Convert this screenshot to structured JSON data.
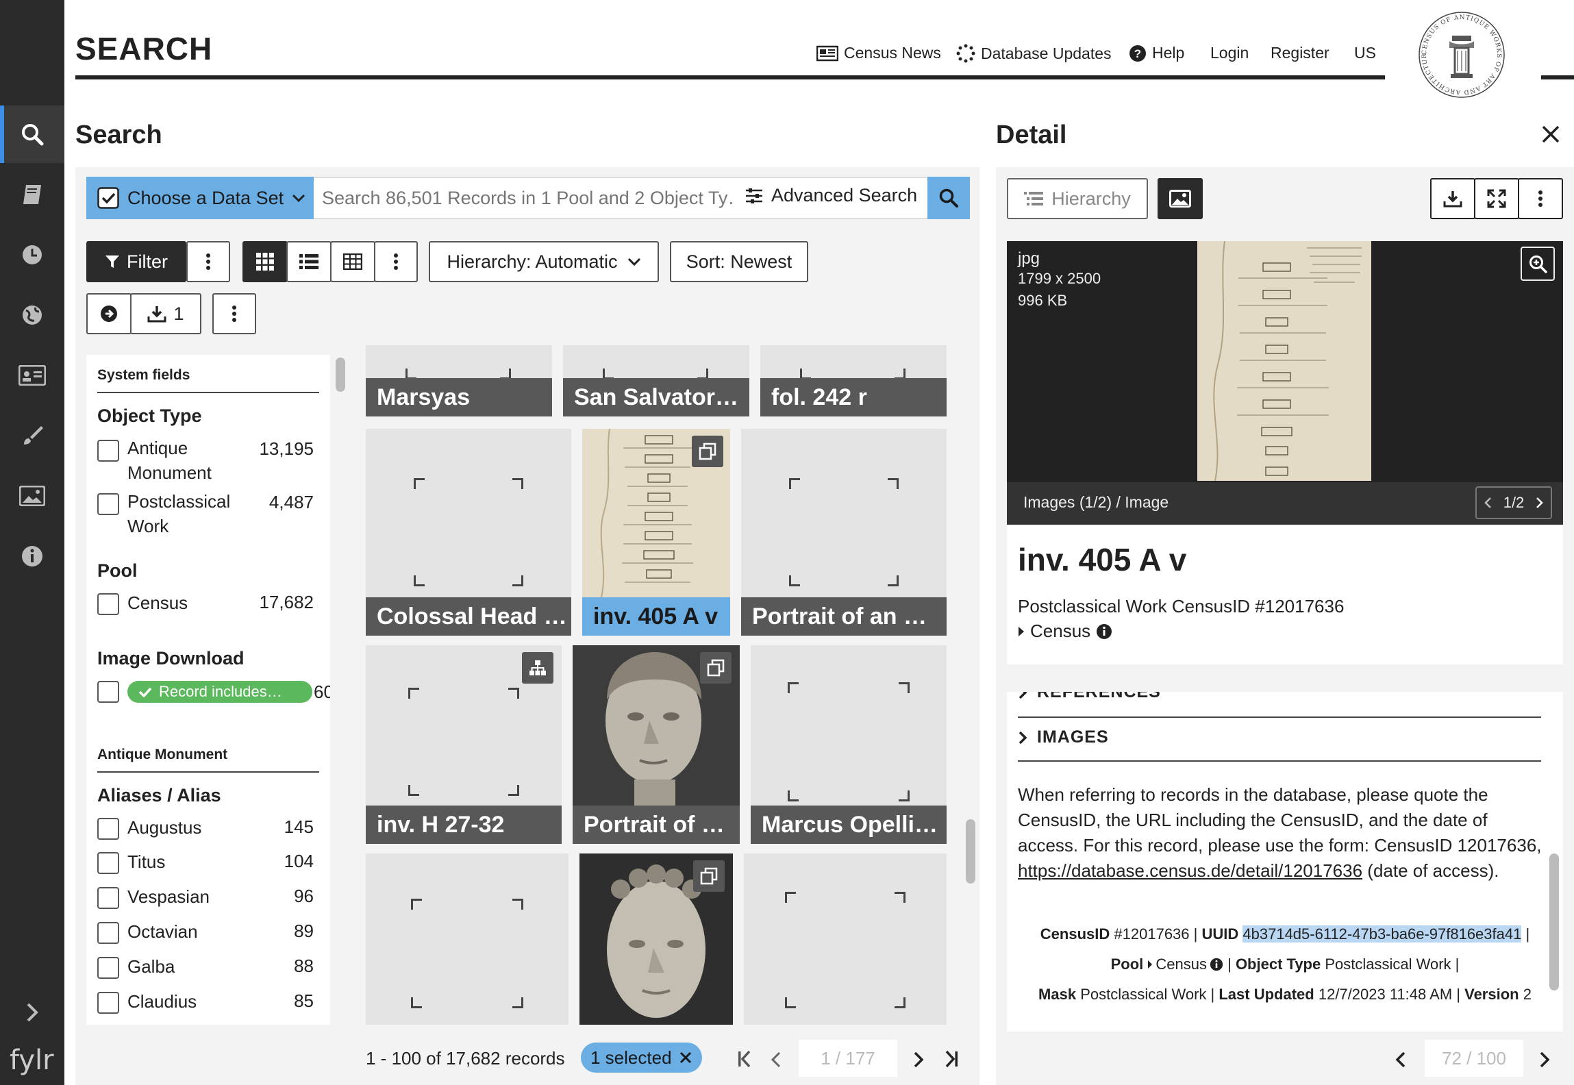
{
  "header": {
    "title": "SEARCH",
    "nav": {
      "news": "Census News",
      "updates": "Database Updates",
      "help": "Help",
      "login": "Login",
      "register": "Register",
      "lang": "US"
    },
    "logo_text": "CENSUS OF ANTIQUE WORKS OF ART AND ARCHITECTURE KNOWN IN THE RENAISSANCE"
  },
  "search_panel": {
    "title": "Search",
    "dataset_label": "Choose a Data Set",
    "search_placeholder": "Search 86,501 Records in 1 Pool and 2 Object Ty…",
    "advanced": "Advanced Search",
    "filter": "Filter",
    "hierarchy": "Hierarchy: Automatic",
    "sort": "Sort: Newest",
    "download_count": "1"
  },
  "facets": {
    "system_fields": "System fields",
    "object_type": {
      "title": "Object Type",
      "items": [
        {
          "label1": "Antique",
          "label2": "Monument",
          "count": "13,195"
        },
        {
          "label1": "Postclassical",
          "label2": "Work",
          "count": "4,487"
        }
      ]
    },
    "pool": {
      "title": "Pool",
      "items": [
        {
          "label": "Census",
          "count": "17,682"
        }
      ]
    },
    "image_download": {
      "title": "Image Download",
      "tag": "Record includes…",
      "count": "60"
    },
    "antique_monument": "Antique Monument",
    "aliases": {
      "title": "Aliases / Alias",
      "items": [
        {
          "label": "Augustus",
          "count": "145"
        },
        {
          "label": "Titus",
          "count": "104"
        },
        {
          "label": "Vespasian",
          "count": "96"
        },
        {
          "label": "Octavian",
          "count": "89"
        },
        {
          "label": "Galba",
          "count": "88"
        },
        {
          "label": "Claudius",
          "count": "85"
        }
      ]
    }
  },
  "results": {
    "tiles": [
      {
        "label": "Marsyas"
      },
      {
        "label": "San Salvator…"
      },
      {
        "label": "fol. 242 r"
      },
      {
        "label": "Colossal Head …"
      },
      {
        "label": "inv. 405 A v"
      },
      {
        "label": "Portrait of an …"
      },
      {
        "label": "inv. H 27-32"
      },
      {
        "label": "Portrait of …"
      },
      {
        "label": "Marcus Opelli…"
      }
    ],
    "summary": "1 - 100 of 17,682 records",
    "selected": "1 selected",
    "page": "1 / 177"
  },
  "detail": {
    "title": "Detail",
    "hierarchy_btn": "Hierarchy",
    "img_type": "jpg",
    "img_dims": "1799 x 2500",
    "img_size": "996 KB",
    "img_caption": "Images (1/2) / Image",
    "img_pager": "1/2",
    "record_title": "inv. 405 A v",
    "record_sub": "Postclassical Work CensusID #12017636",
    "record_pool": "Census",
    "section_refs": "REFERENCES",
    "section_images": "IMAGES",
    "cite_text": "When referring to records in the database, please quote the CensusID, the URL including the CensusID, and the date of access. For this record, please use the form: CensusID 12017636,",
    "cite_url": "https://database.census.de/detail/12017636",
    "cite_tail": " (date of access).",
    "meta": {
      "censusid_k": "CensusID",
      "censusid_v": "#12017636",
      "uuid_k": "UUID",
      "uuid_v": "4b3714d5-6112-47b3-ba6e-97f816e3fa41",
      "pool_k": "Pool",
      "pool_v": "Census",
      "objtype_k": "Object Type",
      "objtype_v": "Postclassical Work",
      "mask_k": "Mask",
      "mask_v": "Postclassical Work",
      "updated_k": "Last Updated",
      "updated_v": "12/7/2023 11:48 AM",
      "version_k": "Version",
      "version_v": "2"
    },
    "pager": "72 / 100"
  },
  "footer_brand": "fylr",
  "colors": {
    "accent": "#3c8ee6",
    "rail": "#2b2b2b",
    "tile_label": "#585858",
    "selected": "#6aaee4",
    "tag": "#5cb85c"
  }
}
